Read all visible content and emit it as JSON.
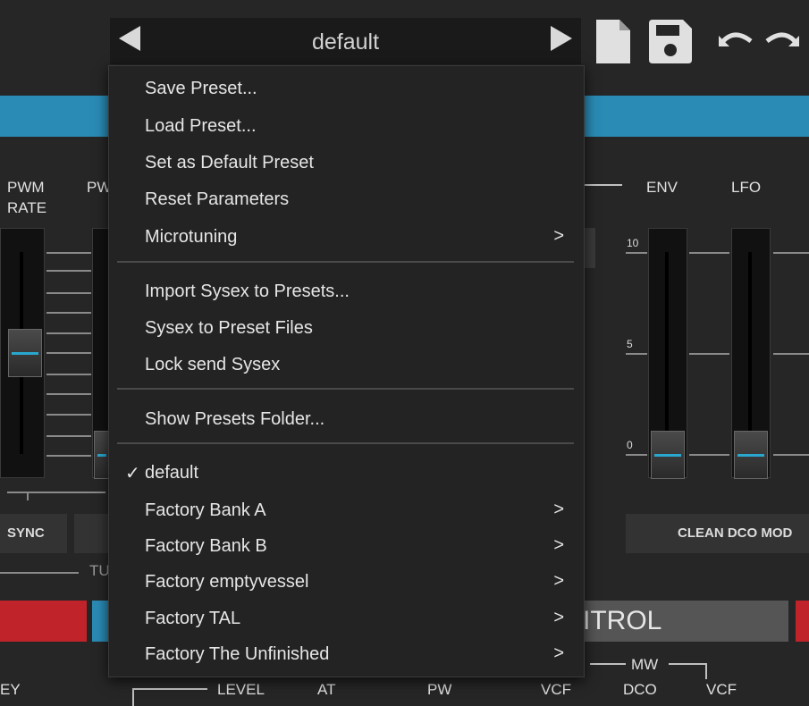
{
  "toolbar": {
    "preset_name": "default",
    "prev_icon": "triangle-left-icon",
    "next_icon": "triangle-right-icon",
    "new_icon": "document-icon",
    "save_icon": "floppy-disk-icon",
    "undo_icon": "undo-icon",
    "redo_icon": "redo-icon"
  },
  "panel": {
    "label_pwm": "PWM",
    "label_rate": "RATE",
    "label_pw": "PW",
    "label_env": "ENV",
    "label_lfo": "LFO",
    "scale_10": "10",
    "scale_5": "5",
    "scale_0": "0",
    "sync_button": "SYNC",
    "clean_button": "CLEAN DCO MOD",
    "tu_label": "TU",
    "control_heading": "ITROL",
    "bottom_key": "EY",
    "bottom_level": "LEVEL",
    "bottom_at": "AT",
    "bottom_pw": "PW",
    "bottom_vcf": "VCF",
    "bottom_mw": "MW",
    "bottom_dco": "DCO",
    "bottom_vcf2": "VCF"
  },
  "menu": {
    "group1": [
      {
        "label": "Save Preset...",
        "submenu": false
      },
      {
        "label": "Load Preset...",
        "submenu": false
      },
      {
        "label": "Set as Default Preset",
        "submenu": false
      },
      {
        "label": "Reset Parameters",
        "submenu": false
      },
      {
        "label": "Microtuning",
        "submenu": true
      }
    ],
    "group2": [
      {
        "label": "Import Sysex to Presets..."
      },
      {
        "label": "Sysex to Preset Files"
      },
      {
        "label": "Lock send Sysex"
      }
    ],
    "group3": [
      {
        "label": "Show Presets Folder..."
      }
    ],
    "group4": [
      {
        "label": "default",
        "checked": true,
        "submenu": false
      },
      {
        "label": "Factory Bank A",
        "submenu": true
      },
      {
        "label": "Factory Bank B",
        "submenu": true
      },
      {
        "label": "Factory emptyvessel",
        "submenu": true
      },
      {
        "label": "Factory TAL",
        "submenu": true
      },
      {
        "label": "Factory The Unfinished",
        "submenu": true
      }
    ],
    "check_glyph": "✓",
    "submenu_glyph": ">"
  },
  "colors": {
    "accent_blue": "#2a8bb5",
    "accent_red": "#c0242a",
    "menu_bg": "#232323"
  }
}
